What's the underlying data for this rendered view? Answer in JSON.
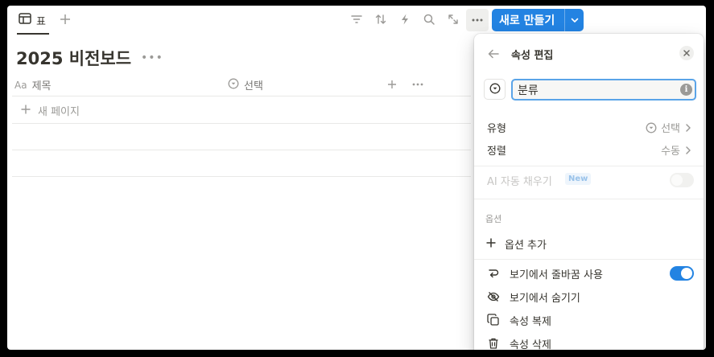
{
  "toolbar": {
    "view_tab_label": "표",
    "new_button_label": "새로 만들기"
  },
  "page": {
    "title": "2025 비전보드",
    "columns": [
      {
        "type_glyph": "Aa",
        "label": "제목"
      },
      {
        "label": "선택"
      }
    ],
    "new_page_label": "새 페이지"
  },
  "panel": {
    "title": "속성 편집",
    "name_value": "분류",
    "type_row": {
      "label": "유형",
      "value": "선택"
    },
    "sort_row": {
      "label": "정렬",
      "value": "수동"
    },
    "ai_fill": {
      "label": "AI 자동 채우기",
      "badge": "New",
      "enabled": false
    },
    "options_section_label": "옵션",
    "add_option_label": "옵션 추가",
    "wrap_in_view": {
      "label": "보기에서 줄바꿈 사용",
      "enabled": true
    },
    "hide_in_view_label": "보기에서 숨기기",
    "duplicate_label": "속성 복제",
    "delete_label": "속성 삭제"
  },
  "colors": {
    "accent": "#2383e2",
    "toggle_on": "#2383e2",
    "toggle_off": "#e9e9e7",
    "input_focus": "#5aa4e8",
    "text": "#37352f",
    "muted": "#9b9a97"
  },
  "icons": {
    "view_tab": "table-icon",
    "toolbar": [
      "filter-icon",
      "sort-icon",
      "lightning-icon",
      "search-icon",
      "expand-icon",
      "more-icon"
    ],
    "panel": [
      "back-arrow-icon",
      "close-icon",
      "select-type-icon",
      "info-icon",
      "chevron-right-icon",
      "plus-icon",
      "wrap-icon",
      "eye-off-icon",
      "duplicate-icon",
      "trash-icon"
    ]
  }
}
